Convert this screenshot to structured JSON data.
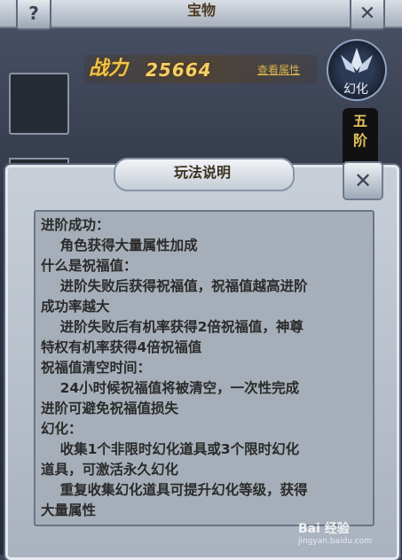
{
  "header": {
    "title": "宝物"
  },
  "power": {
    "label": "战力",
    "value": "25664",
    "view_link": "查看属性"
  },
  "morph": {
    "label": "幻化"
  },
  "rank": {
    "label": "五阶"
  },
  "dialog": {
    "title": "玩法说明",
    "lines": [
      "进阶成功：",
      "    角色获得大量属性加成",
      "什么是祝福值：",
      "    进阶失败后获得祝福值，祝福值越高进阶",
      "成功率越大",
      "    进阶失败后有机率获得2倍祝福值，神尊",
      "特权有机率获得4倍祝福值",
      "祝福值清空时间：",
      "    24小时候祝福值将被清空，一次性完成",
      "进阶可避免祝福值损失",
      "幻化：",
      "    收集1个非限时幻化道具或3个限时幻化",
      "道具，可激活永久幻化",
      "    重复收集幻化道具可提升幻化等级，获得",
      "大量属性"
    ]
  },
  "watermark": {
    "text": "Bai 经验",
    "sub": "jingyan.baidu.com"
  }
}
